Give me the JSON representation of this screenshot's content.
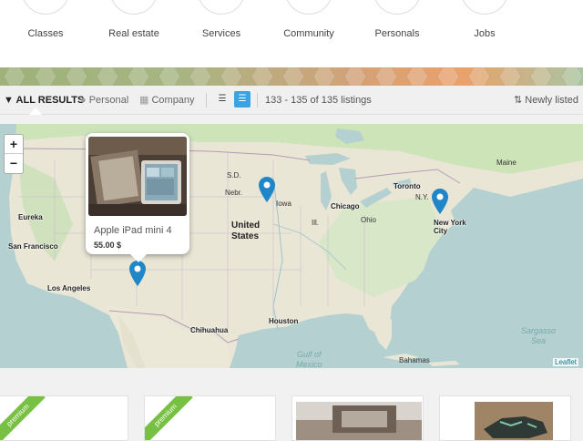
{
  "categories": [
    {
      "label": "Classes"
    },
    {
      "label": "Real estate"
    },
    {
      "label": "Services"
    },
    {
      "label": "Community"
    },
    {
      "label": "Personals"
    },
    {
      "label": "Jobs"
    }
  ],
  "filters": {
    "all_results": "ALL RESULTS",
    "personal": "Personal",
    "company": "Company",
    "count": "133 - 135 of 135 listings",
    "sort": "Newly listed"
  },
  "map": {
    "zoom_in": "+",
    "zoom_out": "−",
    "attribution": "Leaflet",
    "labels": {
      "united_states": "United\nStates",
      "eureka": "Eureka",
      "san_francisco": "San Francisco",
      "los_angeles": "Los Angeles",
      "chicago": "Chicago",
      "toronto": "Toronto",
      "new_york": "New York\nCity",
      "houston": "Houston",
      "chihuahua": "Chihuahua",
      "gulf": "Gulf of\nMexico",
      "sargasso": "Sargasso\nSea",
      "bahamas": "Bahamas",
      "iowa": "Iowa",
      "sd": "S.D.",
      "nebr": "Nebr.",
      "ill": "Ill.",
      "ohio": "Ohio",
      "ny": "N.Y.",
      "me": "Maine"
    }
  },
  "popup": {
    "title": "Apple iPad mini 4",
    "price": "55.00 $",
    "close": "×"
  },
  "cards": [
    {
      "ribbon": "premium"
    },
    {
      "ribbon": "premium"
    }
  ],
  "colors": {
    "accent": "#3aa3e3",
    "pin": "#1f86c8",
    "premium": "#78c043",
    "land": "#e9e6d6",
    "water": "#b5d0d0"
  }
}
